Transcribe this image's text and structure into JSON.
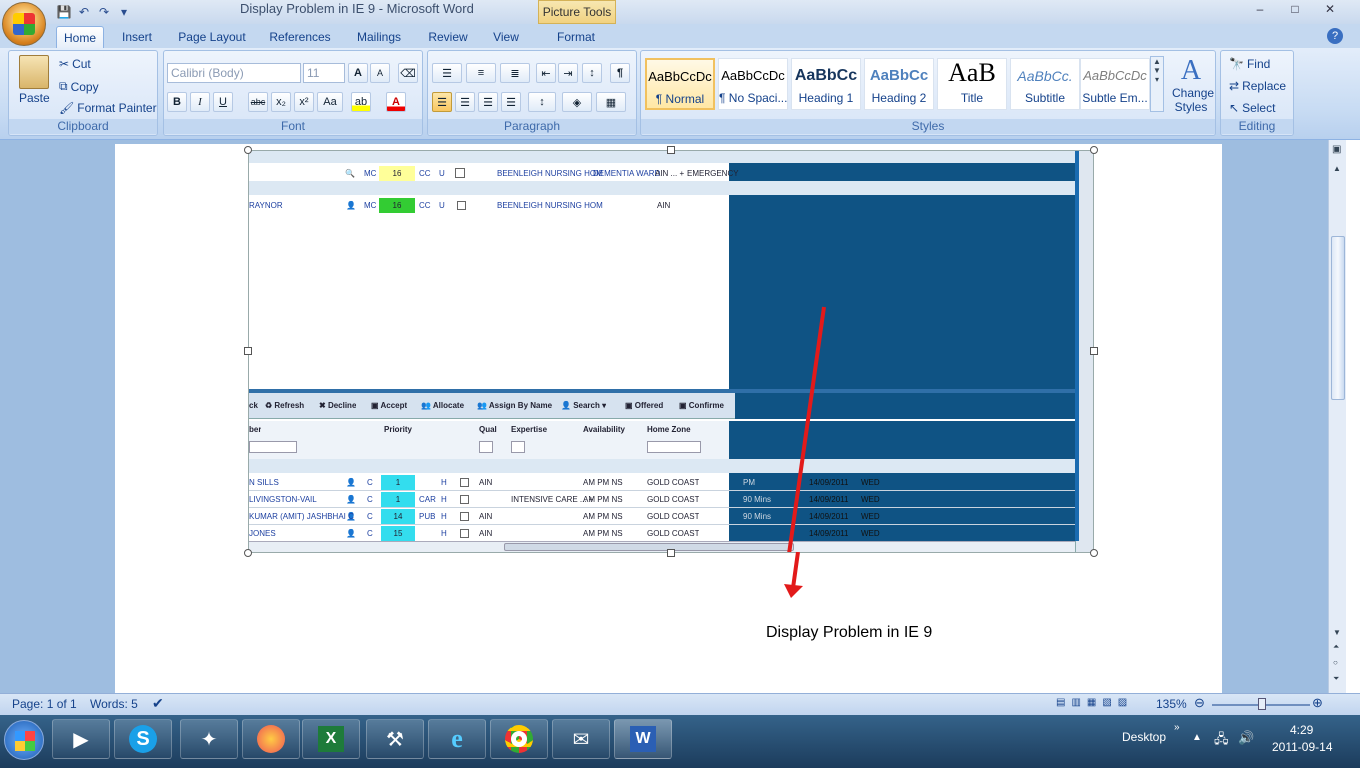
{
  "window": {
    "title": "Display Problem in IE 9 - Microsoft Word",
    "contextual_tab": "Picture Tools",
    "minimize": "–",
    "maximize": "□",
    "close": "✕"
  },
  "tabs": [
    "Home",
    "Insert",
    "Page Layout",
    "References",
    "Mailings",
    "Review",
    "View",
    "Format"
  ],
  "clipboard": {
    "label": "Clipboard",
    "paste": "Paste",
    "cut": "Cut",
    "copy": "Copy",
    "format_painter": "Format Painter"
  },
  "font": {
    "label": "Font",
    "family": "Calibri (Body)",
    "size": "11",
    "bold": "B",
    "italic": "I",
    "underline": "U",
    "strike": "abc",
    "sub": "x₂",
    "sup": "x²",
    "case": "Aa",
    "grow": "A",
    "shrink": "A",
    "highlight": "ab",
    "color": "A"
  },
  "paragraph": {
    "label": "Paragraph",
    "pilcrow": "¶"
  },
  "styles": {
    "label": "Styles",
    "items": [
      {
        "sample": "AaBbCcDc",
        "name": "¶ Normal"
      },
      {
        "sample": "AaBbCcDc",
        "name": "¶ No Spaci..."
      },
      {
        "sample": "AaBbCc",
        "name": "Heading 1"
      },
      {
        "sample": "AaBbCc",
        "name": "Heading 2"
      },
      {
        "sample": "AaB",
        "name": "Title"
      },
      {
        "sample": "AaBbCc.",
        "name": "Subtitle"
      },
      {
        "sample": "AaBbCcDc",
        "name": "Subtle Em..."
      }
    ],
    "change": "Change Styles"
  },
  "editing": {
    "label": "Editing",
    "find": "Find",
    "replace": "Replace",
    "select": "Select"
  },
  "status": {
    "page": "Page: 1 of 1",
    "words": "Words: 5",
    "zoom": "135%"
  },
  "caption": "Display Problem in IE 9",
  "taskbar": {
    "desktop": "Desktop",
    "time": "4:29",
    "date": "2011-09-14"
  },
  "shot": {
    "toprows": [
      {
        "icon": "🔍",
        "mc": "MC",
        "num": "16",
        "cc": "CC",
        "u": "U",
        "facility": "BEENLEIGH NURSING HOM",
        "ward": "DEMENTIA WARD",
        "qual": "AIN ... +",
        "type": "EMERGENCY"
      },
      {
        "name": "RAYNOR",
        "icon": "👤",
        "mc": "MC",
        "num": "16",
        "cc": "CC",
        "u": "U",
        "facility": "BEENLEIGH NURSING HOM",
        "ward": "",
        "qual": "AIN",
        "type": ""
      }
    ],
    "toolbar": [
      "ck",
      "Refresh",
      "Decline",
      "Accept",
      "Allocate",
      "Assign By Name",
      "Search",
      "Offered",
      "Confirme"
    ],
    "headers": {
      "number": "ber",
      "priority": "Priority",
      "qual": "Qual",
      "expertise": "Expertise",
      "availability": "Availability",
      "home_zone": "Home Zone"
    },
    "rows": [
      {
        "name": "N SILLS",
        "c": "C",
        "pri": "1",
        "code": "",
        "h": "H",
        "qual": "AIN",
        "exp": "",
        "av": "AM  PM  NS",
        "zone": "GOLD COAST",
        "r1": "PM",
        "r2": "14/09/2011",
        "r3": "WED"
      },
      {
        "name": "LIVINGSTON-VAIL",
        "c": "C",
        "pri": "1",
        "code": "CAR",
        "h": "H",
        "qual": "",
        "exp": "INTENSIVE CARE ... +",
        "av": "AM  PM  NS",
        "zone": "GOLD COAST",
        "r1": "90 Mins",
        "r2": "14/09/2011",
        "r3": "WED"
      },
      {
        "name": "KUMAR (AMIT) JASHBHAI C",
        "c": "C",
        "pri": "14",
        "code": "PUB",
        "h": "H",
        "qual": "AIN",
        "exp": "",
        "av": "AM  PM  NS",
        "zone": "GOLD COAST",
        "r1": "90 Mins",
        "r2": "14/09/2011",
        "r3": "WED"
      },
      {
        "name": "JONES",
        "c": "C",
        "pri": "15",
        "code": "",
        "h": "H",
        "qual": "AIN",
        "exp": "",
        "av": "AM  PM  NS",
        "zone": "GOLD COAST",
        "r1": "",
        "r2": "14/09/2011",
        "r3": "WED"
      }
    ]
  },
  "colors": {
    "dark_panel": "#0f5384",
    "arrow": "#e21a1a"
  }
}
